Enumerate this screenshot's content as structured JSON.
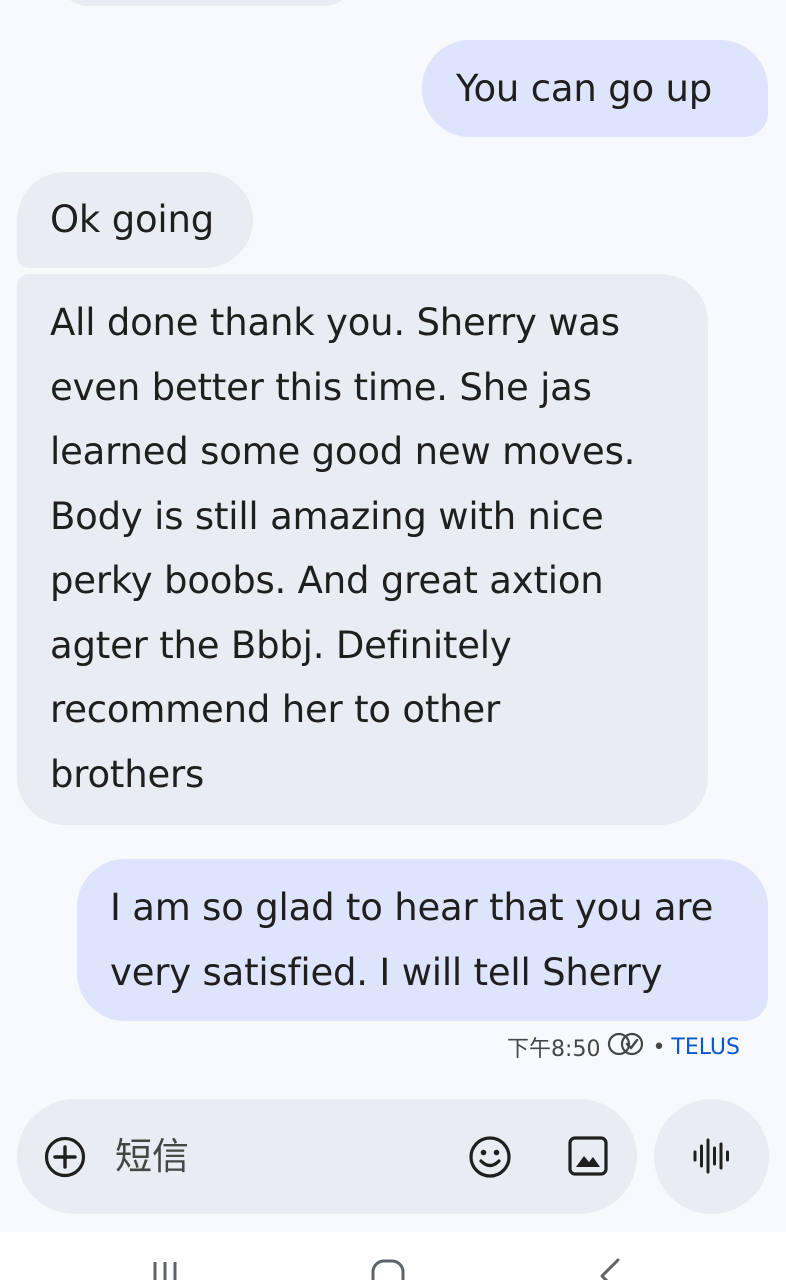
{
  "messages": [
    {
      "direction": "outgoing",
      "text": "You can go up"
    },
    {
      "direction": "incoming",
      "text": "Ok going"
    },
    {
      "direction": "incoming",
      "lines": [
        "All done thank you. Sherry was",
        "even better this time. She jas",
        "learned some good new moves.",
        "Body is still amazing with nice",
        "perky boobs. And great axtion",
        "agter the Bbbj. Definitely",
        "recommend her to other",
        "brothers"
      ]
    },
    {
      "direction": "outgoing",
      "lines": [
        "I am so glad to hear that you are",
        "very satisfied. I will tell Sherry"
      ]
    }
  ],
  "meta": {
    "time": "下午8:50",
    "separator": "•",
    "carrier": "TELUS",
    "status_icon": "delivered-read-icon"
  },
  "compose": {
    "placeholder": "短信",
    "icons": [
      "add-circle-icon",
      "emoji-icon",
      "gallery-icon",
      "voice-waveform-icon"
    ]
  },
  "navigation": {
    "icons": [
      "recent-apps-icon",
      "home-icon",
      "back-icon"
    ]
  },
  "colors": {
    "background": "#f8f9fd",
    "incoming_bubble": "#e9ecf2",
    "outgoing_bubble": "#dde4fb",
    "carrier_text": "#0b57d0"
  }
}
